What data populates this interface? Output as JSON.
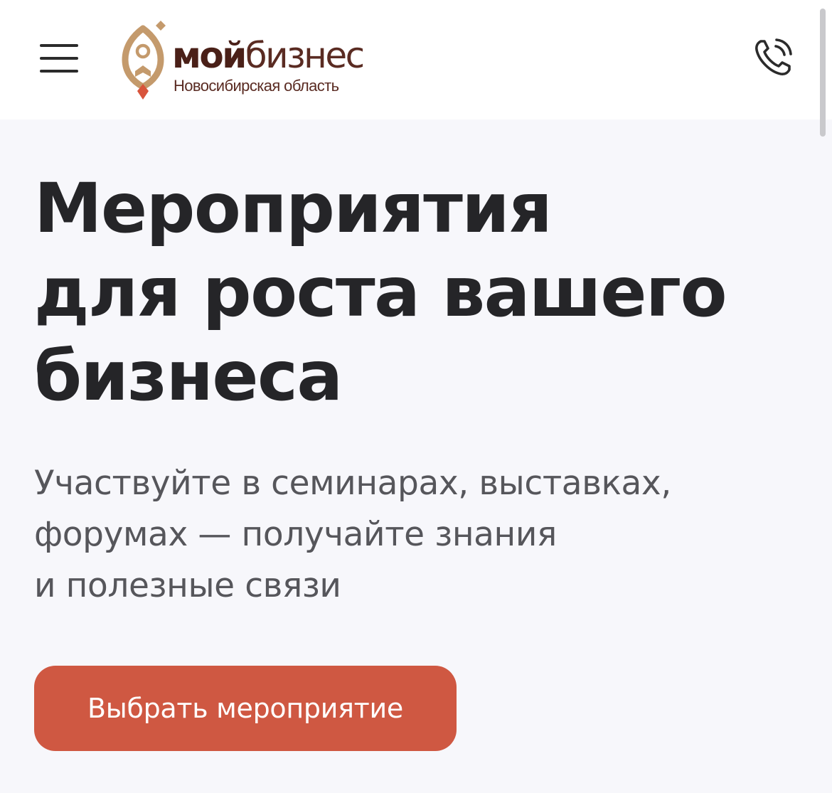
{
  "header": {
    "brand_bold": "мой",
    "brand_light": "бизнес",
    "region": "Новосибирская область",
    "menu_icon": "hamburger-menu-icon",
    "phone_icon": "phone-call-icon",
    "logo_icon": "rocket-pin-icon"
  },
  "hero": {
    "title": "Мероприятия\nдля роста вашего\nбизнеса",
    "subtitle": "Участвуйте в семинарах, выставках,\nфорумах — получайте знания\nи полезные связи",
    "cta_label": "Выбрать мероприятие"
  },
  "colors": {
    "page_background": "#f7f7fb",
    "header_background": "#ffffff",
    "accent": "#cf5842",
    "brand_brown": "#5a2b22",
    "logo_gold": "#c49a6c",
    "title_text": "#252528",
    "subtitle_text": "#56565b"
  }
}
